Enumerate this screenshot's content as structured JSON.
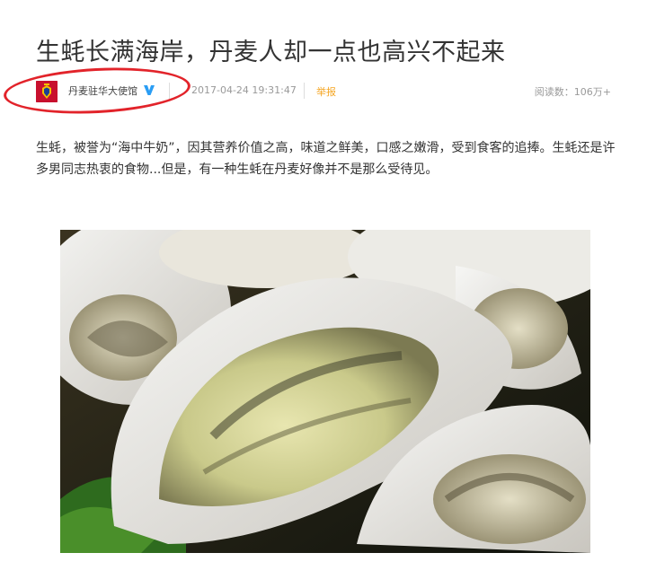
{
  "article": {
    "title": "生蚝长满海岸，丹麦人却一点也高兴不起来",
    "author": "丹麦驻华大使馆",
    "publish_time": "2017-04-24 19:31:47",
    "report_label": "举报",
    "read_count": "阅读数：106万+",
    "body": "生蚝，被誉为“海中牛奶”，因其营养价值之高，味道之鲜美，口感之嫩滑，受到食客的追捧。生蚝还是许多男同志热衷的食物...但是，有一种生蚝在丹麦好像并不是那么受待见。"
  },
  "icons": {
    "avatar": "danish-embassy-crest-icon",
    "verified": "verified-v-icon"
  },
  "colors": {
    "annotation_circle": "#e2232a",
    "report": "#f5a623",
    "verified": "#2a9df4",
    "avatar_bg": "#c8102e"
  }
}
